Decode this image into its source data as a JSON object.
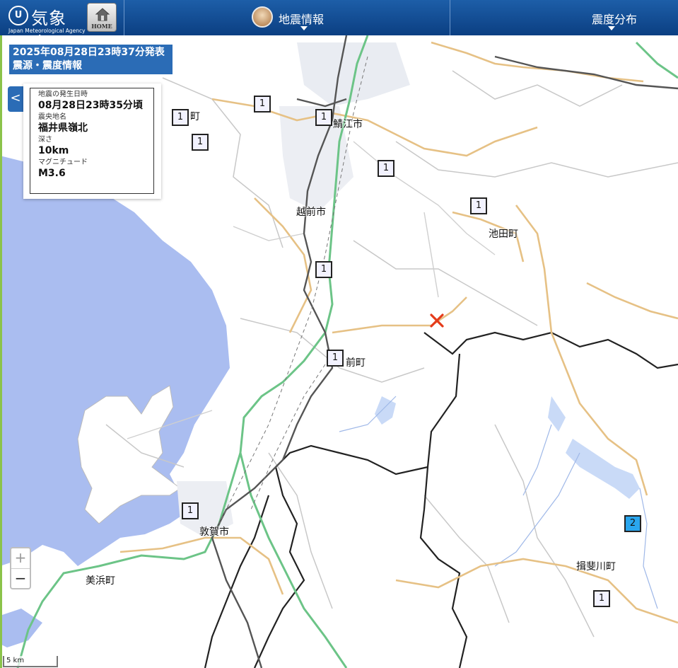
{
  "header": {
    "agency_name": "気象庁",
    "agency_name_en": "Japan Meteorological Agency",
    "logo_glyph": "U",
    "home_label": "HOME",
    "nav_earthquake_label": "地震情報",
    "nav_distribution_label": "震度分布"
  },
  "report": {
    "title_line1": "2025年08月28日23時37分発表",
    "title_line2": "震源・震度情報",
    "collapse_glyph": "<"
  },
  "info": {
    "datetime_label": "地震の発生日時",
    "datetime_value": "08月28日23時35分頃",
    "area_label": "震央地名",
    "area_value": "福井県嶺北",
    "depth_label": "深さ",
    "depth_value": "10km",
    "magnitude_label": "マグニチュード",
    "magnitude_value": "M3.6"
  },
  "places": {
    "town_partial": "町",
    "sabae": "鯖江市",
    "echizen": "越前市",
    "ikeda": "池田町",
    "minamiechizen_partial": "前町",
    "tsuruga": "敦賀市",
    "mihama": "美浜町",
    "ibigawa": "揖斐川町"
  },
  "stations": [
    {
      "intensity": "1"
    },
    {
      "intensity": "1"
    },
    {
      "intensity": "1"
    },
    {
      "intensity": "1"
    },
    {
      "intensity": "1"
    },
    {
      "intensity": "1"
    },
    {
      "intensity": "1"
    },
    {
      "intensity": "1"
    },
    {
      "intensity": "1"
    },
    {
      "intensity": "2"
    },
    {
      "intensity": "1"
    }
  ],
  "zoom": {
    "in_label": "+",
    "out_label": "−"
  },
  "scale": {
    "label": "5 km"
  },
  "colors": {
    "sea": "#aabdf0",
    "land": "#ffffff",
    "header": "#1a57a0",
    "expressway": "#6cc487",
    "national_road": "#e6c185",
    "intensity_1": "#f2f2ff",
    "intensity_2": "#2aa6ee",
    "epicenter": "#e53b1a"
  }
}
